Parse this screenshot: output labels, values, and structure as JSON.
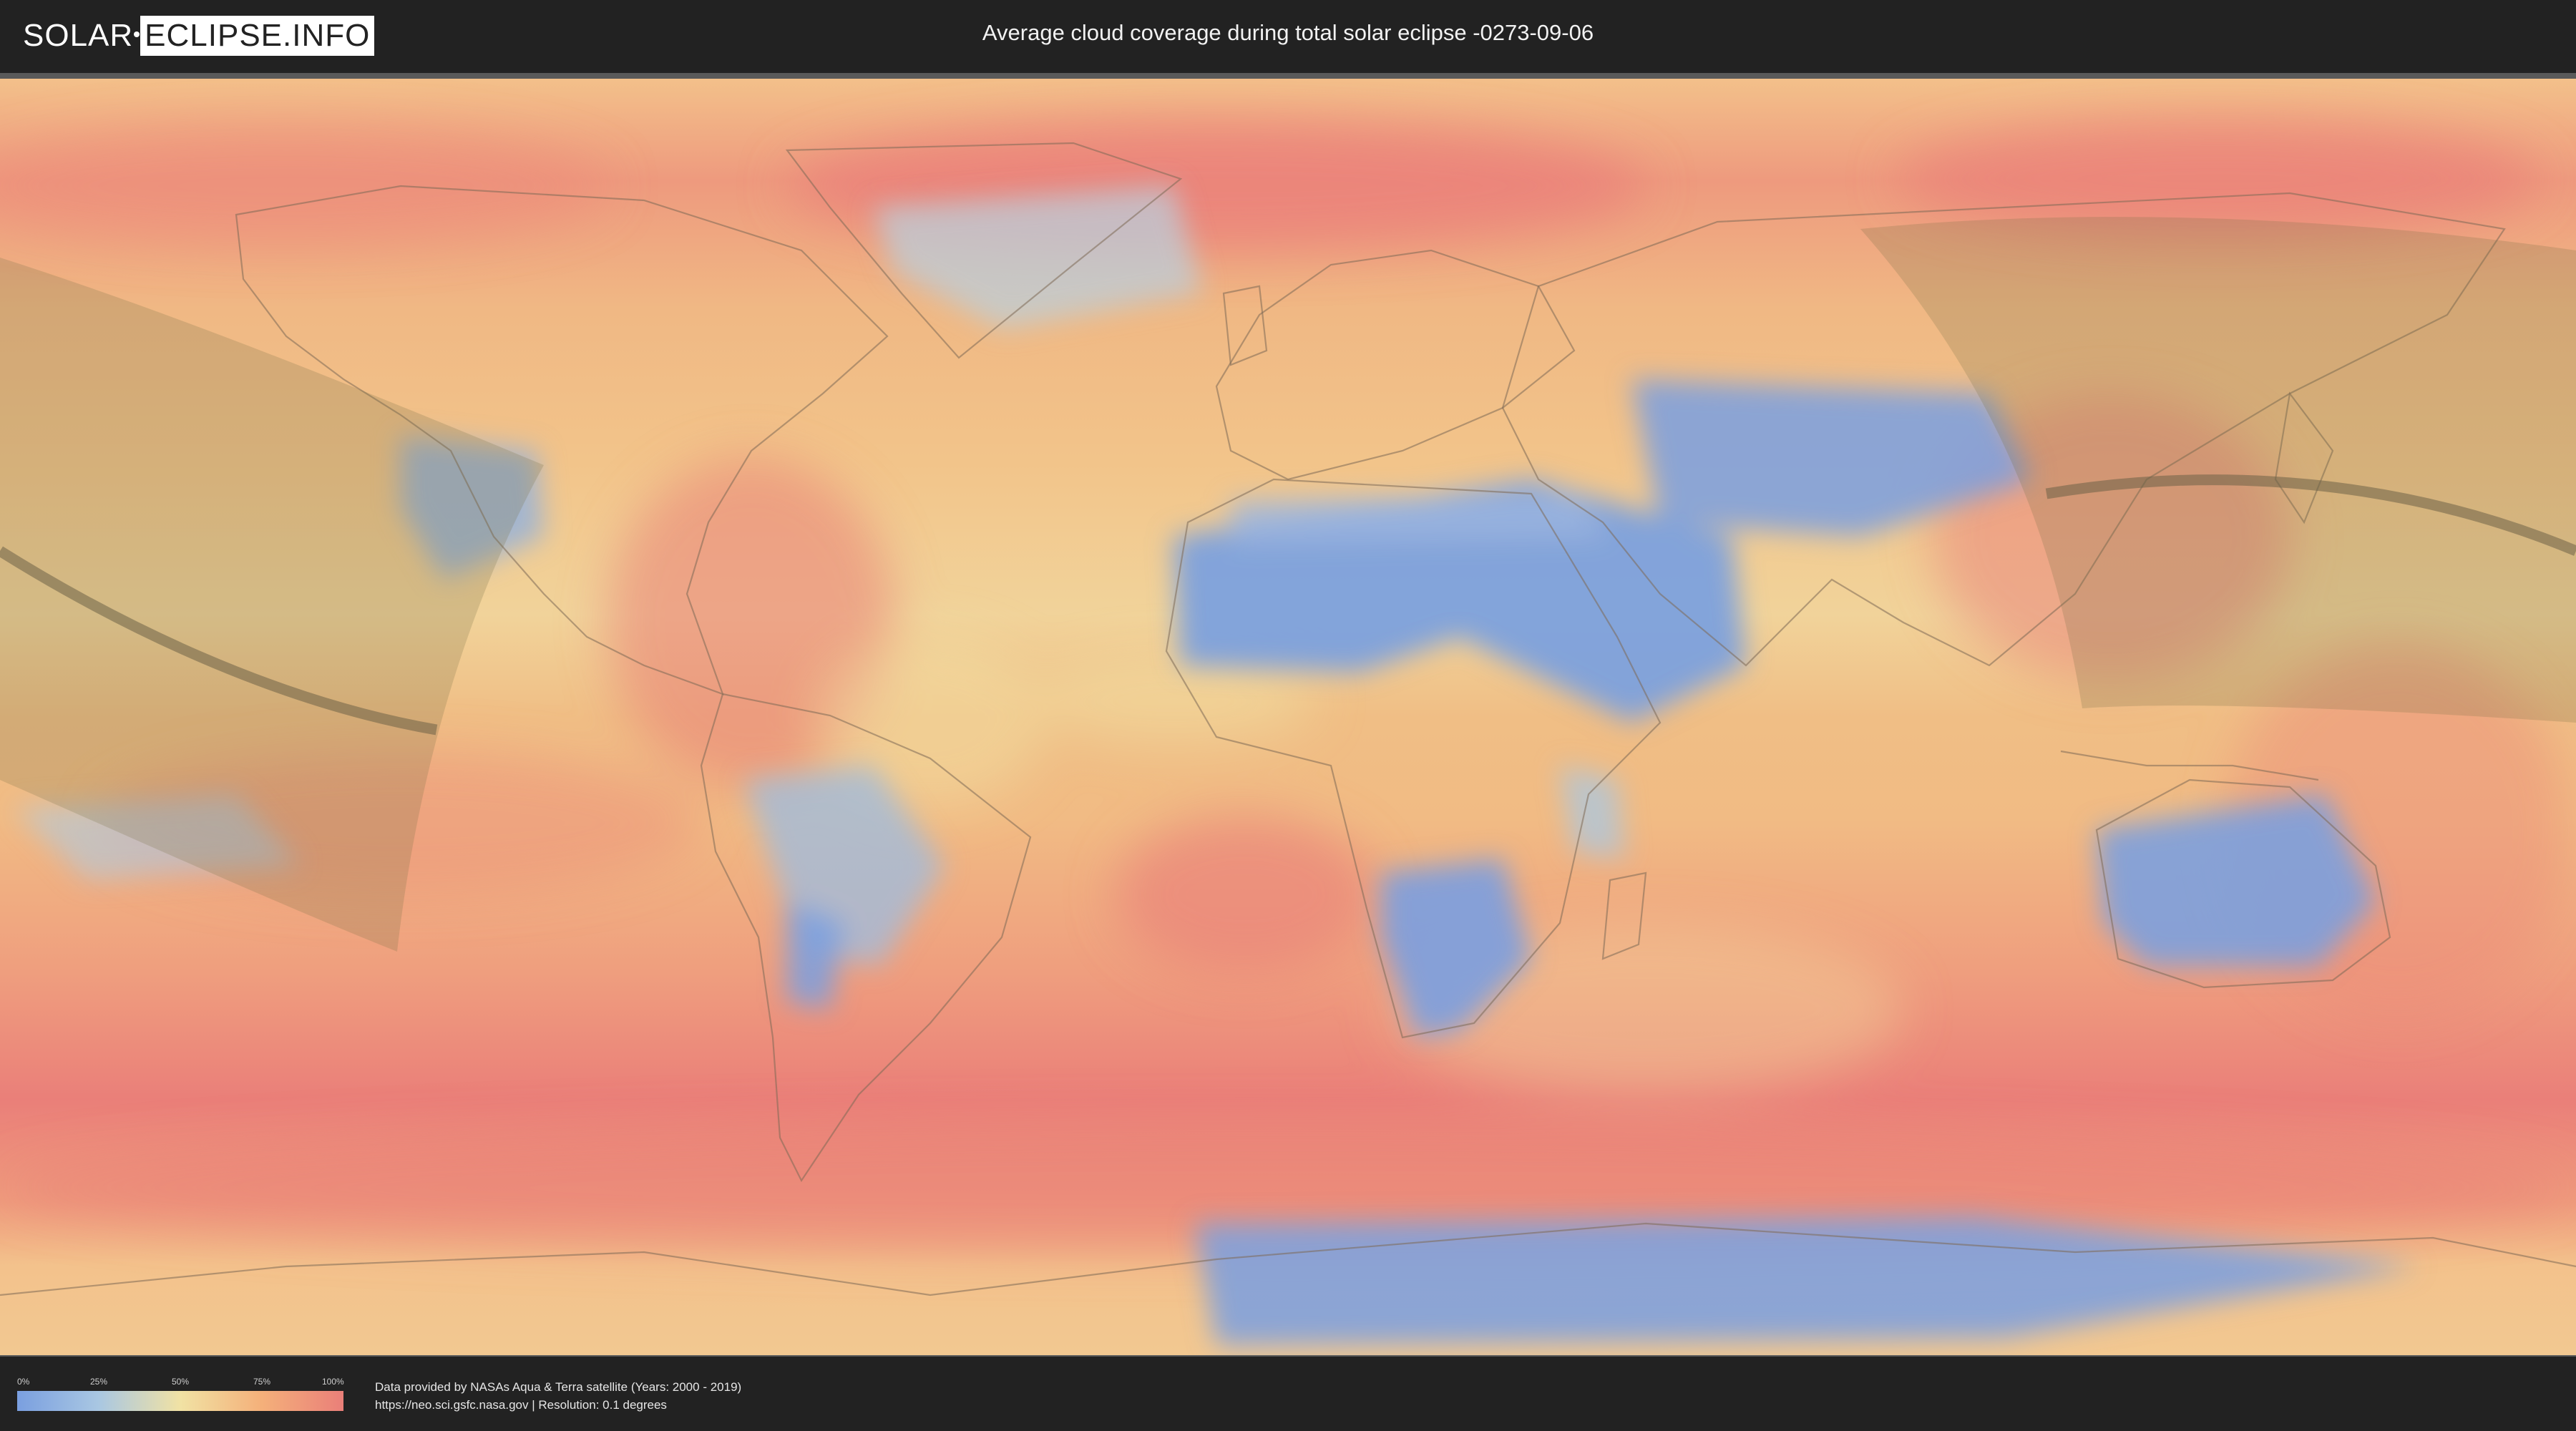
{
  "header": {
    "logo_left": "SOLAR",
    "logo_right": "ECLIPSE.INFO",
    "title": "Average cloud coverage during total solar eclipse -0273-09-06"
  },
  "map": {
    "projection": "equirectangular",
    "layer": "average cloud coverage",
    "eclipse_type": "total solar eclipse",
    "date": "-0273-09-06",
    "colors": {
      "low_cloud": "#7a9fe0",
      "mid_cloud": "#f1e2a4",
      "high_cloud": "#ea7f79",
      "shadow_overlay": "#7a7048",
      "central_line": "#6b6147"
    }
  },
  "legend": {
    "ticks": [
      "0%",
      "25%",
      "50%",
      "75%",
      "100%"
    ],
    "tick_values": [
      0,
      25,
      50,
      75,
      100
    ]
  },
  "footer": {
    "credit_line1": "Data provided by NASAs Aqua & Terra satellite (Years: 2000 - 2019)",
    "credit_line2": "https://neo.sci.gsfc.nasa.gov | Resolution: 0.1 degrees"
  }
}
